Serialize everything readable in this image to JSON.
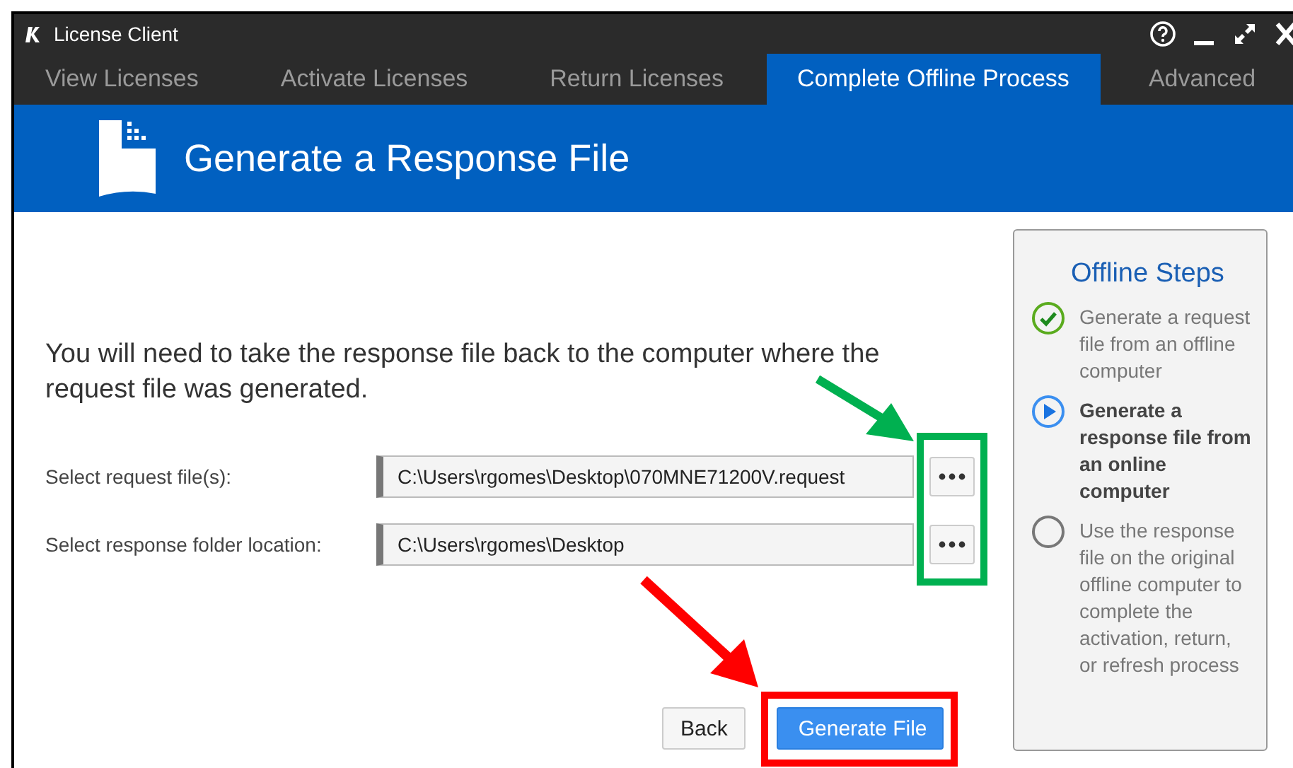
{
  "window": {
    "title": "License Client"
  },
  "tabs": [
    {
      "label": "View Licenses",
      "selected": false
    },
    {
      "label": "Activate Licenses",
      "selected": false
    },
    {
      "label": "Return Licenses",
      "selected": false
    },
    {
      "label": "Complete Offline Process",
      "selected": true
    },
    {
      "label": "Advanced",
      "selected": false
    }
  ],
  "banner": {
    "title": "Generate a Response File"
  },
  "instruction": "You will need to take the response file back to the computer where the request file was generated.",
  "fields": [
    {
      "label": "Select request file(s):",
      "value": "C:\\Users\\rgomes\\Desktop\\070MNE71200V.request"
    },
    {
      "label": "Select response folder location:",
      "value": "C:\\Users\\rgomes\\Desktop"
    }
  ],
  "buttons": [
    {
      "label": "Back",
      "primary": false
    },
    {
      "label": "Generate File",
      "primary": true
    }
  ],
  "steps_panel": {
    "title": "Offline Steps",
    "steps": [
      {
        "kind": "done",
        "text": "Generate a request file from an offline computer"
      },
      {
        "kind": "current",
        "text": "Generate a response file from an online computer"
      },
      {
        "kind": "pending",
        "text": "Use the response file on the original offline computer to complete the activation, return, or refresh process"
      }
    ]
  }
}
